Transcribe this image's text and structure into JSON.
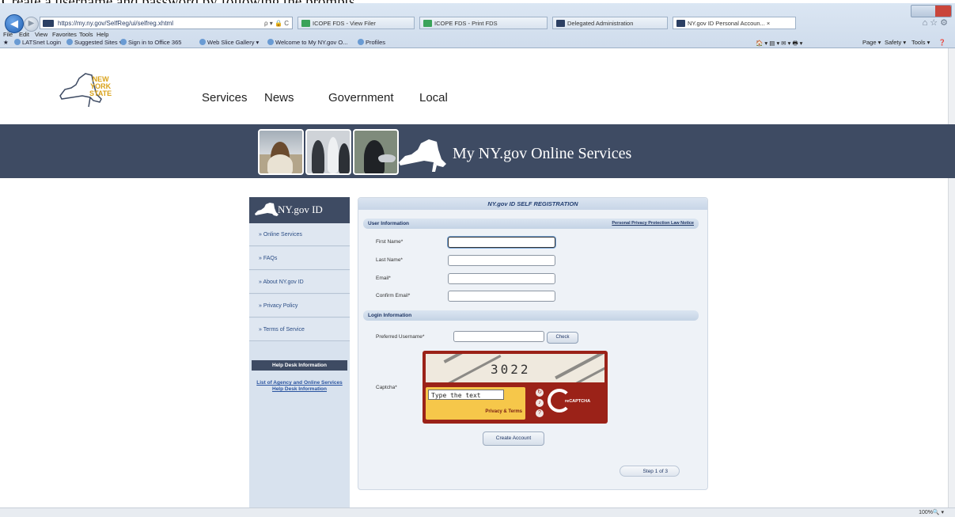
{
  "instruction": "Create a username and password by following the prompts",
  "browser": {
    "url": "https://my.ny.gov/SelfReg/ui/selfreg.xhtml",
    "address_controls": "ρ ▾ 🔒 C",
    "tabs": [
      {
        "label": "ICOPE FDS - View Filer",
        "color": "#3aa35a"
      },
      {
        "label": "ICOPE FDS - Print FDS",
        "color": "#3aa35a"
      },
      {
        "label": "Delegated Administration",
        "color": "#2b3f63"
      },
      {
        "label": "NY.gov ID Personal Accoun... ×",
        "color": "#2b3f63"
      }
    ],
    "menu": [
      "File",
      "Edit",
      "View",
      "Favorites",
      "Tools",
      "Help"
    ],
    "favorites": [
      "LATSnet Login",
      "Suggested Sites ▾",
      "Sign in to Office 365",
      "Web Slice Gallery ▾",
      "Welcome to My NY.gov O...",
      "Profiles"
    ],
    "command_bar": [
      "Page ▾",
      "Safety ▾",
      "Tools ▾"
    ],
    "zoom": "100%"
  },
  "site": {
    "logo_lines": [
      "NEW",
      "YORK",
      "STATE"
    ],
    "nav": [
      "Services",
      "News",
      "Government",
      "Local"
    ],
    "banner_title": "My NY.gov Online Services"
  },
  "sidebar": {
    "heading": "NY.gov ID",
    "items": [
      "Online Services",
      "FAQs",
      "About NY.gov ID",
      "Privacy Policy",
      "Terms of Service"
    ],
    "help_heading": "Help Desk Information",
    "help_link": "List of Agency and Online Services Help Desk Information"
  },
  "form": {
    "title": "NY.gov ID SELF REGISTRATION",
    "user_section": "User Information",
    "privacy_link": "Personal Privacy Protection Law Notice",
    "fields": [
      {
        "label": "First Name*",
        "value": ""
      },
      {
        "label": "Last Name*",
        "value": ""
      },
      {
        "label": "Email*",
        "value": ""
      },
      {
        "label": "Confirm Email*",
        "value": ""
      }
    ],
    "login_section": "Login Information",
    "username_label": "Preferred Username*",
    "username_value": "",
    "check_label": "Check",
    "captcha_label": "Captcha*",
    "captcha_word": "3022",
    "captcha_placeholder": "Type the text",
    "captcha_privacy": "Privacy & Terms",
    "captcha_brand": "reCAPTCHA",
    "create_label": "Create Account",
    "step_label": "Step 1 of 3"
  },
  "colors": {
    "navy": "#3e4b63",
    "captcha_red": "#9b2218",
    "captcha_yellow": "#f6c74a"
  }
}
